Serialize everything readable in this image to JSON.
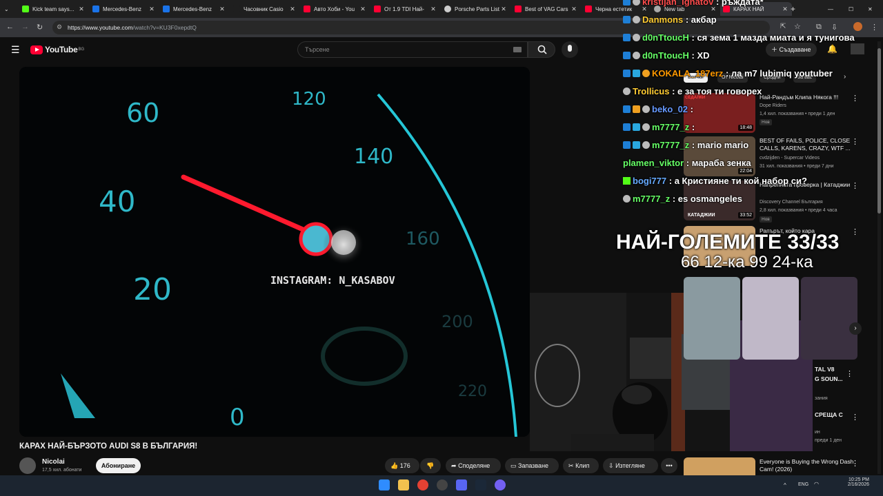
{
  "tabs": [
    {
      "label": "Kick team says...",
      "color": "#53fc18"
    },
    {
      "label": "Mercedes-Benz",
      "color": "#1a73e8"
    },
    {
      "label": "Mercedes-Benz",
      "color": "#1a73e8"
    },
    {
      "label": "Часовник Casio",
      "color": "#ffffff"
    },
    {
      "label": "Авто Хоби - You",
      "color": "#ff0033"
    },
    {
      "label": "От 1.9 TDI Най-",
      "color": "#ff0033"
    },
    {
      "label": "Porsche Parts List",
      "color": "#cccccc"
    },
    {
      "label": "Best of VAG Cars",
      "color": "#ff0033"
    },
    {
      "label": "Черна естетик",
      "color": "#ff0033"
    },
    {
      "label": "New tab",
      "color": "#aaaaaa"
    },
    {
      "label": "КАРАХ НАЙ",
      "color": "#ff0033"
    }
  ],
  "browser": {
    "url_host": "https://www.youtube.com",
    "url_path": "/watch?v=KU3F0xepdtQ",
    "new_tab": "+",
    "min": "—",
    "max": "☐",
    "close": "✕"
  },
  "youtube": {
    "logo_text": "YouTube",
    "country": "BG",
    "search_placeholder": "Търсене",
    "create_label": "Създаване",
    "chips": [
      "Всички",
      "От Nicolai",
      "Сродни",
      "За вас"
    ],
    "video_title": "КАРАХ НАЙ-БЪРЗОТО AUDI S8 В БЪЛГАРИЯ!",
    "channel_name": "Nicolai",
    "subscribers": "17,5 хил. абонати",
    "subscribe_label": "Абониране",
    "likes": "176",
    "share_label": "Споделяне",
    "save_label": "Запазване",
    "clip_label": "Клип",
    "download_label": "Изтегляне",
    "more_label": "•••"
  },
  "player": {
    "speed_labels": [
      "60",
      "40",
      "20",
      "120",
      "140",
      "160",
      "200",
      "220",
      "0"
    ],
    "watermark": "INSTAGRAM: N_KASABOV"
  },
  "recommendations": [
    {
      "title": "Най-Рандъм Клипа Някога !!!",
      "channel": "Dope Riders",
      "meta": "1,4 хил. показвания • преди 1 ден",
      "badge": "Нов",
      "duration": "18:48",
      "thumb_color": "#7a1f1f"
    },
    {
      "title": "BEST OF FAILS, POLICE, CLOSE CALLS, KARENS, CRAZY, WTF ...",
      "channel": "cvdzijden - Supercar Videos",
      "meta": "31 хил. показвания • преди 7 дни",
      "badge": "",
      "duration": "22:04",
      "thumb_color": "#5a4a3a"
    },
    {
      "title": "Напрепната проверка | Катаджии",
      "channel": "Discovery Channel България",
      "meta": "2,8 хил. показвания • преди 4 часа",
      "badge": "Нов",
      "duration": "33:52",
      "thumb_color": "#3a2a2a"
    },
    {
      "title": "Рапърът, който кара",
      "channel": "",
      "meta": "",
      "badge": "",
      "duration": "",
      "thumb_color": "#c8a070"
    },
    {
      "title": "Everyone is Buying the Wrong Dash Cam! (2026)",
      "channel": "",
      "meta": "",
      "badge": "",
      "duration": "",
      "thumb_color": "#d0a060"
    }
  ],
  "rec_partial": [
    "TAL V8",
    "G SOUN...",
    "зания",
    "СРЕЩА С",
    "ин",
    "преди 1 ден"
  ],
  "thumb_labels": {
    "kataji": "КАТАДЖИИ",
    "sedalki": "СЕДАЛКИ"
  },
  "chat": [
    {
      "user": "kristijan_ignatov",
      "msg": ": ръждата*",
      "color": "#ff4d4d"
    },
    {
      "user": "Danmons",
      "msg": ": акбар",
      "color": "#ffcc33"
    },
    {
      "user": "d0nTtoucH",
      "msg": ": ся зема 1 мазда миата и я тунигова",
      "color": "#66ff66"
    },
    {
      "user": "d0nTtoucH",
      "msg": ": XD",
      "color": "#66ff66"
    },
    {
      "user": "KOKALA_187erz",
      "msg": ": ла m7 lubimiq youtuber",
      "color": "#ff9900"
    },
    {
      "user": "Trollicus",
      "msg": ": е за тоя ти говорех",
      "color": "#ffcc33"
    },
    {
      "user": "beko_02",
      "msg": ":",
      "color": "#6699ff"
    },
    {
      "user": "m7777_z",
      "msg": ":",
      "color": "#66ff66"
    },
    {
      "user": "m7777_z",
      "msg": ": mario mario",
      "color": "#66ff66"
    },
    {
      "user": "plamen_viktor",
      "msg": ": мараба зенка",
      "color": "#66ff66"
    },
    {
      "user": "bogi777",
      "msg": ": а Кристияне ти кой набор си?",
      "color": "#66aaff"
    },
    {
      "user": "m7777_z",
      "msg": ": es osmangeles",
      "color": "#66ff66"
    }
  ],
  "overlay": {
    "line1": "НАЙ-ГОЛЕМИТЕ 33/33",
    "line2": "66 12-ка 99 24-ка"
  },
  "taskbar": {
    "lang": "ENG",
    "time": "10:25 PM",
    "date": "2/16/2026"
  },
  "colors": {
    "accent": "#ff0033",
    "needle": "#ff1a2e",
    "gauge": "#25c6d6",
    "subscribe_bg": "#f1f1f1"
  }
}
